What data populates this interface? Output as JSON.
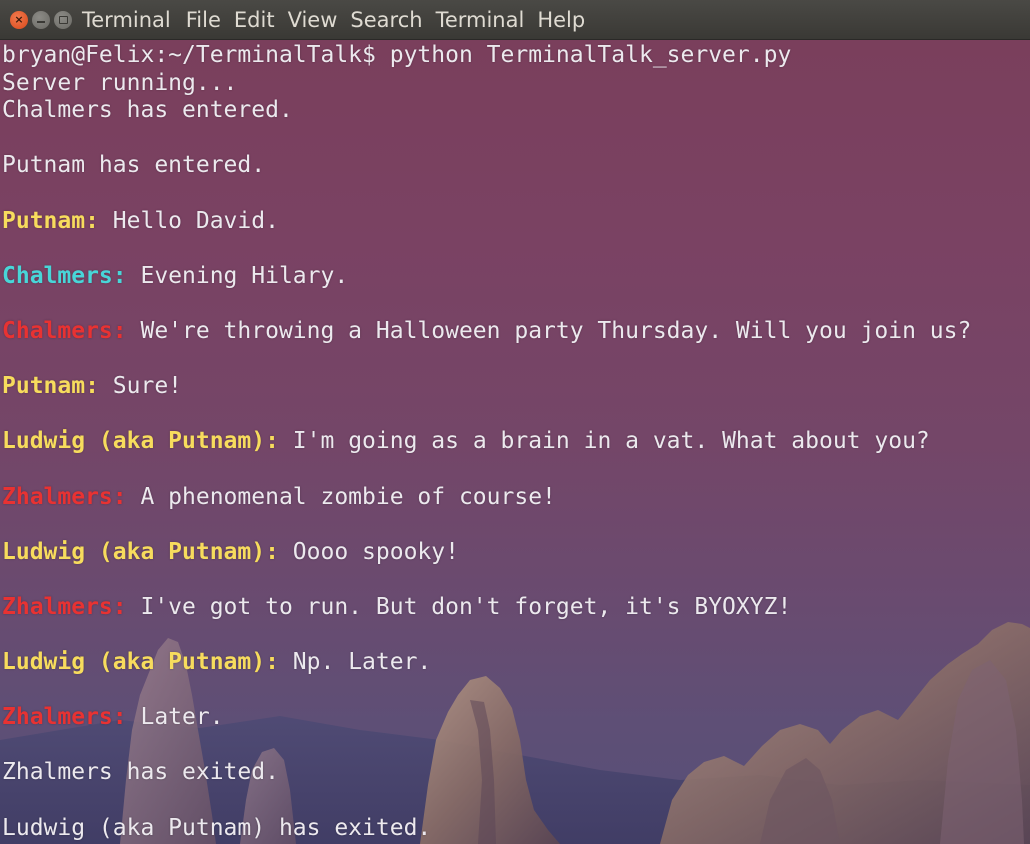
{
  "window": {
    "title": "Terminal",
    "menu": [
      "File",
      "Edit",
      "View",
      "Search",
      "Terminal",
      "Help"
    ]
  },
  "colors": {
    "yellow": "#f7dc5d",
    "cyan": "#48d6d8",
    "red": "#e83232",
    "text": "#ece9ee"
  },
  "terminal": {
    "lines": [
      {
        "text": "bryan@Felix:~/TerminalTalk$ python TerminalTalk_server.py"
      },
      {
        "text": "Server running..."
      },
      {
        "text": "Chalmers has entered."
      },
      {
        "text": ""
      },
      {
        "text": "Putnam has entered."
      },
      {
        "text": ""
      },
      {
        "speaker": "Putnam:",
        "speaker_color": "yellow",
        "text": " Hello David."
      },
      {
        "text": ""
      },
      {
        "speaker": "Chalmers:",
        "speaker_color": "cyan",
        "text": " Evening Hilary."
      },
      {
        "text": ""
      },
      {
        "speaker": "Chalmers:",
        "speaker_color": "red",
        "text": " We're throwing a Halloween party Thursday. Will you join us?"
      },
      {
        "text": ""
      },
      {
        "speaker": "Putnam:",
        "speaker_color": "yellow",
        "text": " Sure!"
      },
      {
        "text": ""
      },
      {
        "speaker": "Ludwig (aka Putnam):",
        "speaker_color": "yellow",
        "text": " I'm going as a brain in a vat. What about you?"
      },
      {
        "text": ""
      },
      {
        "speaker": "Zhalmers:",
        "speaker_color": "red",
        "text": " A phenomenal zombie of course!"
      },
      {
        "text": ""
      },
      {
        "speaker": "Ludwig (aka Putnam):",
        "speaker_color": "yellow",
        "text": " Oooo spooky!"
      },
      {
        "text": ""
      },
      {
        "speaker": "Zhalmers:",
        "speaker_color": "red",
        "text": " I've got to run. But don't forget, it's BYOXYZ!"
      },
      {
        "text": ""
      },
      {
        "speaker": "Ludwig (aka Putnam):",
        "speaker_color": "yellow",
        "text": " Np. Later."
      },
      {
        "text": ""
      },
      {
        "speaker": "Zhalmers:",
        "speaker_color": "red",
        "text": " Later."
      },
      {
        "text": ""
      },
      {
        "text": "Zhalmers has exited."
      },
      {
        "text": ""
      },
      {
        "text": "Ludwig (aka Putnam) has exited."
      }
    ]
  }
}
